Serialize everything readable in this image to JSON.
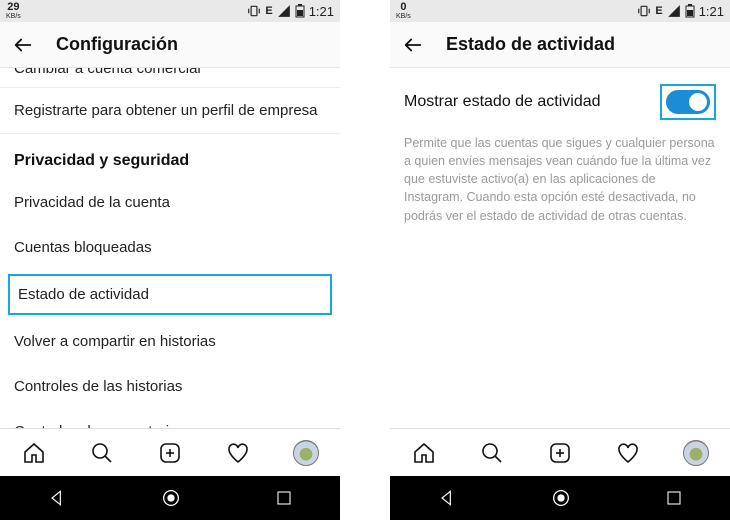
{
  "statusbar_left": {
    "speed_a": "29",
    "speed_b": "0",
    "unit": "KB/s"
  },
  "statusbar_right": {
    "net": "E",
    "time": "1:21"
  },
  "left": {
    "title": "Configuración",
    "cut_item": "Cambiar a cuenta comercial",
    "item_register": "Registrarte para obtener un perfil de empresa",
    "section": "Privacidad y seguridad",
    "items": [
      "Privacidad de la cuenta",
      "Cuentas bloqueadas",
      "Estado de actividad",
      "Volver a compartir en historias",
      "Controles de las historias",
      "Controles de comentarios"
    ]
  },
  "right": {
    "title": "Estado de actividad",
    "setting_label": "Mostrar estado de actividad",
    "description": "Permite que las cuentas que sigues y cualquier persona a quien envíes mensajes vean cuándo fue la última vez que estuviste activo(a) en las aplicaciones de Instagram. Cuando esta opción esté desactivada, no podrás ver el estado de actividad de otras cuentas."
  }
}
